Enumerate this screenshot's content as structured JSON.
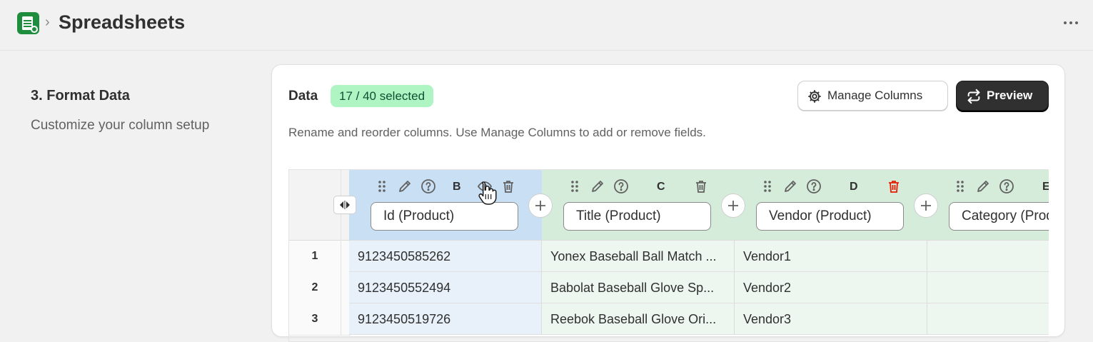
{
  "header": {
    "title": "Spreadsheets",
    "separator": "›",
    "app_icon": "google-sheets-icon",
    "more_icon": "ellipsis-icon"
  },
  "section": {
    "title": "3. Format Data",
    "description": "Customize your column setup"
  },
  "card": {
    "title": "Data",
    "badge": "17 / 40 selected",
    "manage_label": "Manage Columns",
    "preview_label": "Preview",
    "description": "Rename and reorder columns. Use Manage Columns to add or remove fields."
  },
  "columns": [
    {
      "letter": "B",
      "name": "Id (Product)"
    },
    {
      "letter": "C",
      "name": "Title (Product)"
    },
    {
      "letter": "D",
      "name": "Vendor (Product)"
    },
    {
      "letter": "E",
      "name": "Category (Product)"
    }
  ],
  "rows": [
    {
      "num": "1",
      "cells": [
        "9123450585262",
        "Yonex Baseball Ball Match ...",
        "Vendor1",
        ""
      ]
    },
    {
      "num": "2",
      "cells": [
        "9123450552494",
        "Babolat Baseball Glove Sp...",
        "Vendor2",
        ""
      ]
    },
    {
      "num": "3",
      "cells": [
        "9123450519726",
        "Reebok Baseball Glove Ori...",
        "Vendor3",
        ""
      ]
    }
  ],
  "colors": {
    "badge_bg": "#aff5c3",
    "selected_column": "#c9dff4",
    "column_header": "#d6ecdb",
    "delete_active": "#e51c00",
    "primary_button": "#303030"
  }
}
